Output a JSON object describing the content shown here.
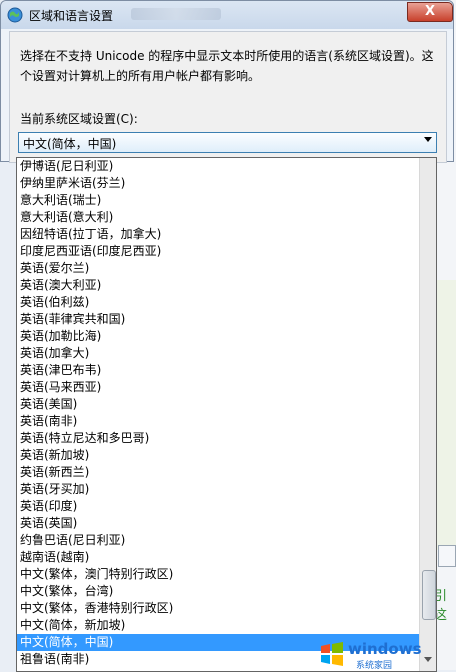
{
  "window": {
    "title": "区域和语言设置",
    "close_label": "X"
  },
  "description": "选择在不支持 Unicode 的程序中显示文本时所使用的语言(系统区域设置)。这个设置对计算机上的所有用户帐户都有影响。",
  "combo": {
    "label": "当前系统区域设置(C):",
    "selected": "中文(简体，中国)"
  },
  "list": {
    "items": [
      "伊博语(尼日利亚)",
      "伊纳里萨米语(芬兰)",
      "意大利语(瑞士)",
      "意大利语(意大利)",
      "因纽特语(拉丁语，加拿大)",
      "印度尼西亚语(印度尼西亚)",
      "英语(爱尔兰)",
      "英语(澳大利亚)",
      "英语(伯利兹)",
      "英语(菲律宾共和国)",
      "英语(加勒比海)",
      "英语(加拿大)",
      "英语(津巴布韦)",
      "英语(马来西亚)",
      "英语(美国)",
      "英语(南非)",
      "英语(特立尼达和多巴哥)",
      "英语(新加坡)",
      "英语(新西兰)",
      "英语(牙买加)",
      "英语(印度)",
      "英语(英国)",
      "约鲁巴语(尼日利亚)",
      "越南语(越南)",
      "中文(繁体，澳门特别行政区)",
      "中文(繁体，台湾)",
      "中文(繁体，香港特别行政区)",
      "中文(简体，新加坡)",
      "中文(简体，中国)",
      "祖鲁语(南非)"
    ],
    "selected_index": 28
  },
  "background": {
    "right_text": "引这"
  },
  "watermark": {
    "brand": "windows",
    "sub": "系统家园"
  },
  "colors": {
    "selection": "#3399ff",
    "close": "#c8402b"
  }
}
